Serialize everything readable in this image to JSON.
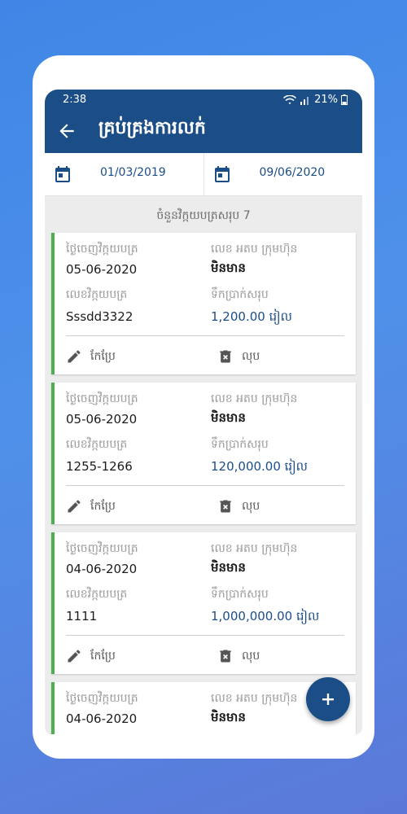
{
  "status_bar": {
    "time": "2:38",
    "battery": "21%"
  },
  "header": {
    "title": "គ្រប់គ្រងការលក់"
  },
  "date_filter": {
    "start": "01/03/2019",
    "end": "09/06/2020"
  },
  "summary": {
    "count_text": "ចំនួនវិក្កយបត្រសរុប 7"
  },
  "labels": {
    "issue_date": "ថ្ងៃចេញវិក្កយបត្រ",
    "tax_company": "លេខ អតប ក្រុមហ៊ុន",
    "invoice_no": "លេខវិក្កយបត្រ",
    "total": "ទឹកប្រាក់សរុប",
    "edit": "កែប្រែ",
    "delete": "លុប",
    "currency": "រៀល"
  },
  "invoices": [
    {
      "date": "05-06-2020",
      "tax_no": "មិនមាន",
      "invoice_no": "Sssdd3322",
      "amount": "1,200.00"
    },
    {
      "date": "05-06-2020",
      "tax_no": "មិនមាន",
      "invoice_no": "1255-1266",
      "amount": "120,000.00"
    },
    {
      "date": "04-06-2020",
      "tax_no": "មិនមាន",
      "invoice_no": "1111",
      "amount": "1,000,000.00"
    },
    {
      "date": "04-06-2020",
      "tax_no": "មិនមាន"
    }
  ],
  "colors": {
    "primary": "#1b4d87",
    "accent_green": "#4caf50"
  }
}
